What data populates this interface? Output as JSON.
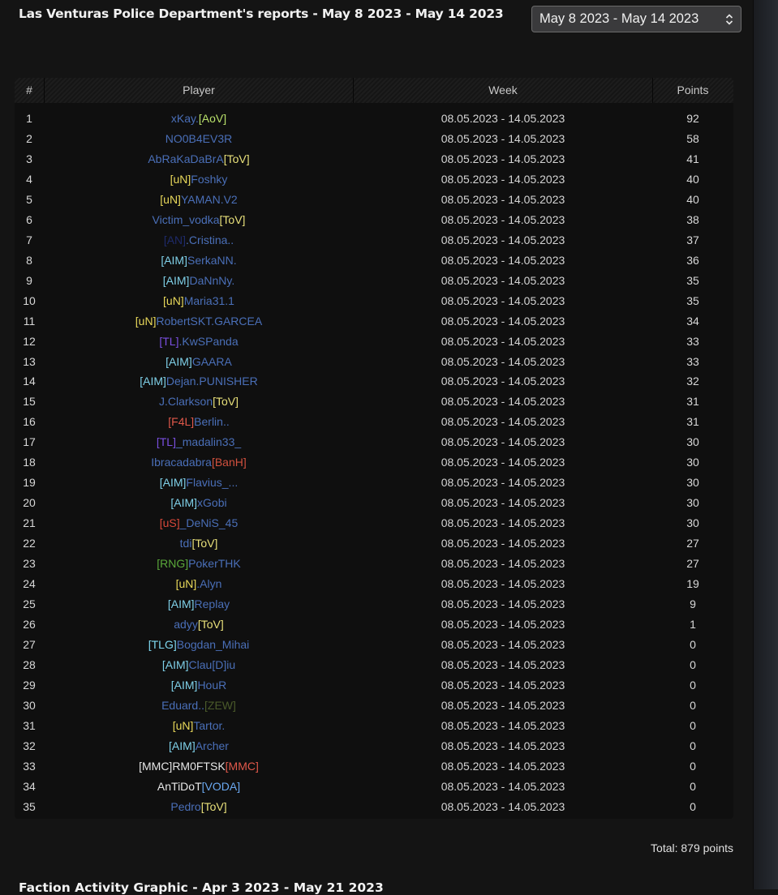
{
  "page_title": "Las Venturas Police Department's reports - May 8 2023 - May 14 2023",
  "week_select": {
    "value": "May 8 2023 - May 14 2023",
    "icon": "chevron-up-down-icon"
  },
  "table": {
    "columns": [
      "#",
      "Player",
      "Week",
      "Points"
    ],
    "rows": [
      {
        "rank": "1",
        "prefix": "",
        "name": "xKay.",
        "suffix": "[AoV]",
        "tag_color": "#b8e06a",
        "week": "08.05.2023 - 14.05.2023",
        "points": "92"
      },
      {
        "rank": "2",
        "prefix": "",
        "name": "NO0B4EV3R",
        "suffix": "",
        "tag_color": "",
        "week": "08.05.2023 - 14.05.2023",
        "points": "58"
      },
      {
        "rank": "3",
        "prefix": "",
        "name": "AbRaKaDaBrA",
        "suffix": "[ToV]",
        "tag_color": "#e8e07a",
        "week": "08.05.2023 - 14.05.2023",
        "points": "41"
      },
      {
        "rank": "4",
        "prefix": "[uN]",
        "name": "Foshky",
        "suffix": "",
        "tag_color": "#e8d85a",
        "week": "08.05.2023 - 14.05.2023",
        "points": "40"
      },
      {
        "rank": "5",
        "prefix": "[uN]",
        "name": "YAMAN.V2",
        "suffix": "",
        "tag_color": "#e8d85a",
        "week": "08.05.2023 - 14.05.2023",
        "points": "40"
      },
      {
        "rank": "6",
        "prefix": "",
        "name": "Victim_vodka",
        "suffix": "[ToV]",
        "tag_color": "#e8e07a",
        "week": "08.05.2023 - 14.05.2023",
        "points": "38"
      },
      {
        "rank": "7",
        "prefix": "[AN]",
        "name": ".Cristina..",
        "suffix": "",
        "tag_color": "#1e2a6a",
        "week": "08.05.2023 - 14.05.2023",
        "points": "37"
      },
      {
        "rank": "8",
        "prefix": "[AIM]",
        "name": "SerkaNN.",
        "suffix": "",
        "tag_color": "#7fd0e8",
        "week": "08.05.2023 - 14.05.2023",
        "points": "36"
      },
      {
        "rank": "9",
        "prefix": "[AIM]",
        "name": "DaNnNy.",
        "suffix": "",
        "tag_color": "#7fd0e8",
        "week": "08.05.2023 - 14.05.2023",
        "points": "35"
      },
      {
        "rank": "10",
        "prefix": "[uN]",
        "name": "Maria31.1",
        "suffix": "",
        "tag_color": "#e8d85a",
        "week": "08.05.2023 - 14.05.2023",
        "points": "35"
      },
      {
        "rank": "11",
        "prefix": "[uN]",
        "name": "RobertSKT.GARCEA",
        "suffix": "",
        "tag_color": "#e8d85a",
        "week": "08.05.2023 - 14.05.2023",
        "points": "34"
      },
      {
        "rank": "12",
        "prefix": "[TL]",
        "name": ".KwSPanda",
        "suffix": "",
        "tag_color": "#7a4fe0",
        "week": "08.05.2023 - 14.05.2023",
        "points": "33"
      },
      {
        "rank": "13",
        "prefix": "[AIM]",
        "name": "GAARA",
        "suffix": "",
        "tag_color": "#7fd0e8",
        "week": "08.05.2023 - 14.05.2023",
        "points": "33"
      },
      {
        "rank": "14",
        "prefix": "[AIM]",
        "name": "Dejan.PUNISHER",
        "suffix": "",
        "tag_color": "#7fd0e8",
        "week": "08.05.2023 - 14.05.2023",
        "points": "32"
      },
      {
        "rank": "15",
        "prefix": "",
        "name": "J.Clarkson",
        "suffix": "[ToV]",
        "tag_color": "#e8e07a",
        "week": "08.05.2023 - 14.05.2023",
        "points": "31"
      },
      {
        "rank": "16",
        "prefix": "[F4L]",
        "name": "Berlin..",
        "suffix": "",
        "tag_color": "#e0584a",
        "week": "08.05.2023 - 14.05.2023",
        "points": "31"
      },
      {
        "rank": "17",
        "prefix": "[TL]",
        "name": "_madalin33_",
        "suffix": "",
        "tag_color": "#7a4fe0",
        "week": "08.05.2023 - 14.05.2023",
        "points": "30"
      },
      {
        "rank": "18",
        "prefix": "",
        "name": "Ibracadabra",
        "suffix": "[BanH]",
        "tag_color": "#d0503e",
        "week": "08.05.2023 - 14.05.2023",
        "points": "30"
      },
      {
        "rank": "19",
        "prefix": "[AIM]",
        "name": "Flavius_...",
        "suffix": "",
        "tag_color": "#7fd0e8",
        "week": "08.05.2023 - 14.05.2023",
        "points": "30"
      },
      {
        "rank": "20",
        "prefix": "[AIM]",
        "name": "xGobi",
        "suffix": "",
        "tag_color": "#7fd0e8",
        "week": "08.05.2023 - 14.05.2023",
        "points": "30"
      },
      {
        "rank": "21",
        "prefix": "[uS]",
        "name": "_DeNiS_45",
        "suffix": "",
        "tag_color": "#d8483a",
        "week": "08.05.2023 - 14.05.2023",
        "points": "30"
      },
      {
        "rank": "22",
        "prefix": "",
        "name": "tdi",
        "suffix": "[ToV]",
        "tag_color": "#e8e07a",
        "week": "08.05.2023 - 14.05.2023",
        "points": "27"
      },
      {
        "rank": "23",
        "prefix": "[RNG]",
        "name": "PokerTHK",
        "suffix": "",
        "tag_color": "#5aa83a",
        "week": "08.05.2023 - 14.05.2023",
        "points": "27"
      },
      {
        "rank": "24",
        "prefix": "[uN]",
        "name": ".Alyn",
        "suffix": "",
        "tag_color": "#e8d85a",
        "week": "08.05.2023 - 14.05.2023",
        "points": "19"
      },
      {
        "rank": "25",
        "prefix": "[AIM]",
        "name": "Replay",
        "suffix": "",
        "tag_color": "#7fd0e8",
        "week": "08.05.2023 - 14.05.2023",
        "points": "9"
      },
      {
        "rank": "26",
        "prefix": "",
        "name": "adyy",
        "suffix": "[ToV]",
        "tag_color": "#e8e07a",
        "week": "08.05.2023 - 14.05.2023",
        "points": "1"
      },
      {
        "rank": "27",
        "prefix": "[TLG]",
        "name": "Bogdan_Mihai",
        "suffix": "",
        "tag_color": "#7fd8f0",
        "week": "08.05.2023 - 14.05.2023",
        "points": "0"
      },
      {
        "rank": "28",
        "prefix": "[AIM]",
        "name": "Clau[D]iu",
        "suffix": "",
        "tag_color": "#7fd0e8",
        "week": "08.05.2023 - 14.05.2023",
        "points": "0"
      },
      {
        "rank": "29",
        "prefix": "[AIM]",
        "name": "HouR",
        "suffix": "",
        "tag_color": "#7fd0e8",
        "week": "08.05.2023 - 14.05.2023",
        "points": "0"
      },
      {
        "rank": "30",
        "prefix": "",
        "name": "Eduard..",
        "suffix": "[ZEW]",
        "tag_color": "#4a5a2a",
        "week": "08.05.2023 - 14.05.2023",
        "points": "0"
      },
      {
        "rank": "31",
        "prefix": "[uN]",
        "name": "Tartor.",
        "suffix": "",
        "tag_color": "#e8d85a",
        "week": "08.05.2023 - 14.05.2023",
        "points": "0"
      },
      {
        "rank": "32",
        "prefix": "[AIM]",
        "name": "Archer",
        "suffix": "",
        "tag_color": "#7fd0e8",
        "week": "08.05.2023 - 14.05.2023",
        "points": "0"
      },
      {
        "rank": "33",
        "prefix": "",
        "name": "[MMC]RM0FTSK",
        "suffix": "[MMC]",
        "tag_color": "#e0584a",
        "name_color": "#e6e6e6",
        "week": "08.05.2023 - 14.05.2023",
        "points": "0"
      },
      {
        "rank": "34",
        "prefix": "",
        "name": "AnTiDoT",
        "suffix": "[VODA]",
        "tag_color": "#6aa8f0",
        "name_color": "#e6e6e6",
        "week": "08.05.2023 - 14.05.2023",
        "points": "0"
      },
      {
        "rank": "35",
        "prefix": "",
        "name": "Pedro",
        "suffix": "[ToV]",
        "tag_color": "#e8e07a",
        "week": "08.05.2023 - 14.05.2023",
        "points": "0"
      }
    ]
  },
  "total": "Total: 879 points",
  "next_section_title": "Faction Activity Graphic - Apr 3 2023 - May 21 2023",
  "colors": {
    "name_default": "#4a6fb8"
  }
}
